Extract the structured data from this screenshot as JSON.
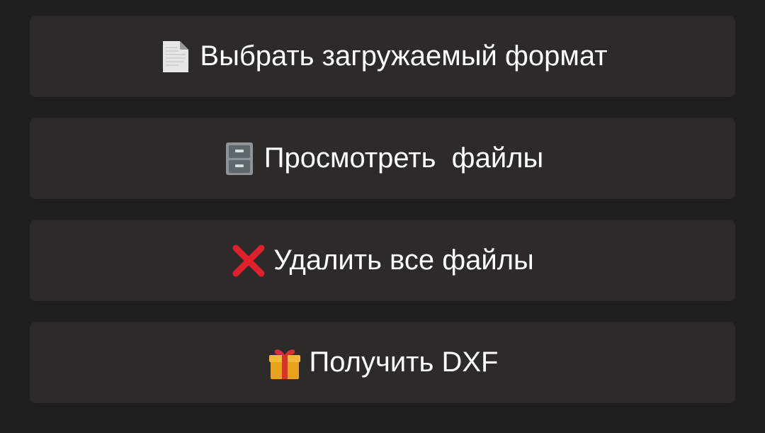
{
  "keyboard": {
    "buttons": [
      {
        "icon": "page-document-icon",
        "label": "Выбрать загружаемый формат"
      },
      {
        "icon": "file-cabinet-icon",
        "label": "Просмотреть  файлы"
      },
      {
        "icon": "red-cross-icon",
        "label": "Удалить все файлы"
      },
      {
        "icon": "gift-icon",
        "label": "Получить DXF"
      }
    ]
  },
  "colors": {
    "background": "#1f1f1f",
    "button": "#2c2b2a",
    "text": "#ffffff",
    "cross": "#e0202a",
    "gift": "#e8a21c"
  }
}
